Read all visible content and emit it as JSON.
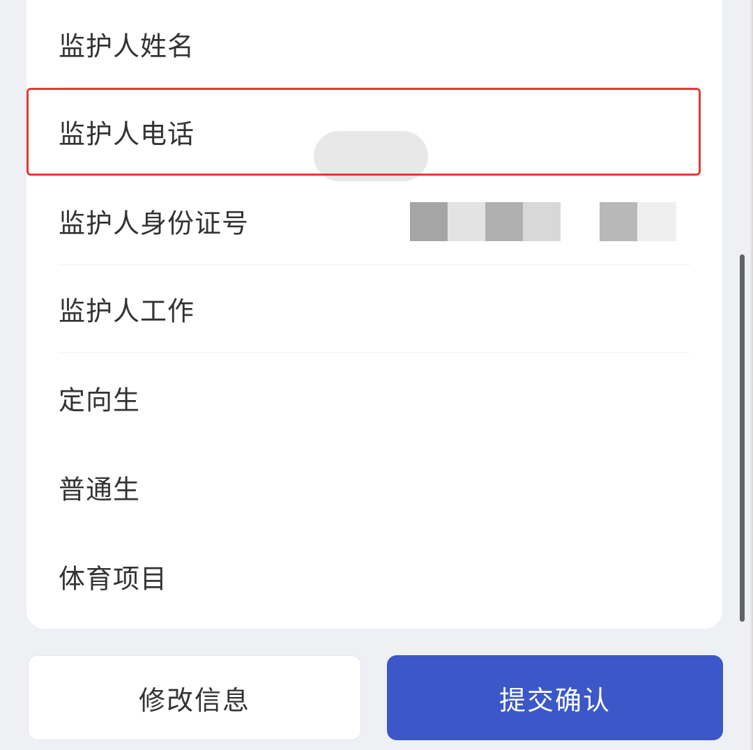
{
  "form": {
    "rows": [
      {
        "label": "监护人姓名"
      },
      {
        "label": "监护人电话"
      },
      {
        "label": "监护人身份证号"
      },
      {
        "label": "监护人工作"
      },
      {
        "label": "定向生"
      },
      {
        "label": "普通生"
      },
      {
        "label": "体育项目"
      }
    ]
  },
  "actions": {
    "edit_label": "修改信息",
    "submit_label": "提交确认"
  },
  "colors": {
    "accent": "#3b57c8",
    "highlight": "#e53935",
    "background": "#eef0f4"
  }
}
